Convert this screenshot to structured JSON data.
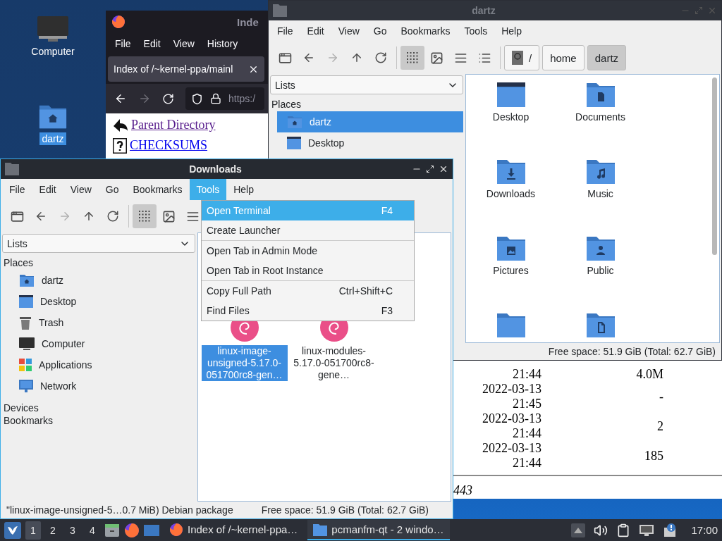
{
  "desktop_icons": [
    {
      "label": "Computer",
      "kind": "computer",
      "selected": false
    },
    {
      "label": "dartz",
      "kind": "home",
      "selected": true
    }
  ],
  "browser": {
    "title": "Inde",
    "menu": [
      "File",
      "Edit",
      "View",
      "History"
    ],
    "tab_title": "Index of /~kernel-ppa/mainl",
    "url": "https:/",
    "links": [
      {
        "label": "Parent Directory",
        "kind": "parent",
        "visited": true
      },
      {
        "label": "CHECKSUMS",
        "kind": "unknown",
        "visited": false
      }
    ],
    "rows": [
      {
        "modified": "21:44",
        "size": "4.0M"
      },
      {
        "modified": "2022-03-13 21:45",
        "size": "-"
      },
      {
        "modified": "2022-03-13 21:44",
        "size": "2"
      },
      {
        "modified": "2022-03-13 21:44",
        "size": "185"
      }
    ],
    "footer": "443"
  },
  "windows": [
    {
      "title": "dartz",
      "active": false,
      "menu": [
        {
          "label": "File",
          "selected": false
        },
        {
          "label": "Edit",
          "selected": false
        },
        {
          "label": "View",
          "selected": false
        },
        {
          "label": "Go",
          "selected": false
        },
        {
          "label": "Bookmarks",
          "selected": false
        },
        {
          "label": "Tools",
          "selected": false
        },
        {
          "label": "Help",
          "selected": false
        }
      ],
      "view_modes": [
        {
          "kind": "icons",
          "selected": true
        },
        {
          "kind": "thumbnails",
          "selected": false
        },
        {
          "kind": "compact",
          "selected": false
        },
        {
          "kind": "details",
          "selected": false
        }
      ],
      "path": [
        {
          "label": "/",
          "kind": "root",
          "selected": false
        },
        {
          "label": "home",
          "kind": "dir",
          "selected": false
        },
        {
          "label": "dartz",
          "kind": "dir",
          "selected": true
        }
      ],
      "list_selector": "Lists",
      "places_heading": "Places",
      "places": [
        {
          "label": "dartz",
          "kind": "home",
          "selected": true
        },
        {
          "label": "Desktop",
          "kind": "desktop",
          "selected": false
        }
      ],
      "files": [
        {
          "label": "Desktop",
          "kind": "desktop"
        },
        {
          "label": "Documents",
          "kind": "documents"
        },
        {
          "label": "Downloads",
          "kind": "downloads"
        },
        {
          "label": "Music",
          "kind": "music"
        },
        {
          "label": "Pictures",
          "kind": "pictures"
        },
        {
          "label": "Public",
          "kind": "public"
        },
        {
          "kind": "folder"
        },
        {
          "kind": "file-folder"
        }
      ],
      "status": {
        "free_space": "Free space: 51.9 GiB (Total: 62.7 GiB)"
      }
    },
    {
      "title": "Downloads",
      "active": true,
      "menu": [
        {
          "label": "File",
          "selected": false
        },
        {
          "label": "Edit",
          "selected": false
        },
        {
          "label": "View",
          "selected": false
        },
        {
          "label": "Go",
          "selected": false
        },
        {
          "label": "Bookmarks",
          "selected": false
        },
        {
          "label": "Tools",
          "selected": true
        },
        {
          "label": "Help",
          "selected": false
        }
      ],
      "view_modes": [
        {
          "kind": "icons",
          "selected": true
        },
        {
          "kind": "thumbnails",
          "selected": false
        },
        {
          "kind": "compact",
          "selected": false
        }
      ],
      "list_selector": "Lists",
      "places_heading": "Places",
      "places": [
        {
          "label": "dartz",
          "kind": "home",
          "selected": false
        },
        {
          "label": "Desktop",
          "kind": "desktop",
          "selected": false
        },
        {
          "label": "Trash",
          "kind": "trash",
          "selected": false
        },
        {
          "label": "Computer",
          "kind": "computer",
          "selected": false
        },
        {
          "label": "Applications",
          "kind": "applications",
          "selected": false
        },
        {
          "label": "Network",
          "kind": "network",
          "selected": false
        }
      ],
      "devices_heading": "Devices",
      "bookmarks_heading": "Bookmarks",
      "files": [
        {
          "label": "linux-image-unsigned-5.17.0-051700rc8-gen…",
          "kind": "package",
          "selected": true
        },
        {
          "label": "linux-modules-5.17.0-051700rc8-gene…",
          "kind": "package",
          "selected": false
        }
      ],
      "dropdown": [
        [
          {
            "label": "Open Terminal",
            "shortcut": "F4",
            "selected": true
          },
          {
            "label": "Create Launcher",
            "selected": false
          }
        ],
        [
          {
            "label": "Open Tab in Admin Mode",
            "selected": false
          },
          {
            "label": "Open Tab in Root Instance",
            "selected": false
          }
        ],
        [
          {
            "label": "Copy Full Path",
            "shortcut": "Ctrl+Shift+C",
            "selected": false
          },
          {
            "label": "Find Files",
            "shortcut": "F3",
            "selected": false
          }
        ]
      ],
      "status": {
        "selection": "\"linux-image-unsigned-5…0.7 MiB) Debian package",
        "free_space": "Free space: 51.9 GiB (Total: 62.7 GiB)"
      }
    }
  ],
  "taskbar": {
    "workspaces": [
      {
        "label": "1",
        "selected": true
      },
      {
        "label": "2",
        "selected": false
      },
      {
        "label": "3",
        "selected": false
      },
      {
        "label": "4",
        "selected": false
      }
    ],
    "tasks": [
      {
        "title": "Index of /~kernel-ppa…",
        "kind": "browser",
        "selected": false
      },
      {
        "title": "pcmanfm-qt - 2 windo…",
        "kind": "files",
        "selected": true
      }
    ],
    "clock": "17:00"
  }
}
